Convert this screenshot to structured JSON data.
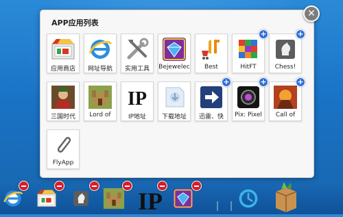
{
  "panel": {
    "title": "APP应用列表",
    "close_glyph": "✕"
  },
  "apps": [
    {
      "label": "应用商店",
      "icon": "app-store-icon",
      "add": false
    },
    {
      "label": "网址导航",
      "icon": "ie-browser-icon",
      "add": false
    },
    {
      "label": "实用工具",
      "icon": "tools-icon",
      "add": false
    },
    {
      "label": "Bejewelec",
      "icon": "bejeweled-gem-icon",
      "add": false
    },
    {
      "label": "Best",
      "icon": "best-cart-icon",
      "add": false
    },
    {
      "label": "HitFT",
      "icon": "hitft-blocks-icon",
      "add": true
    },
    {
      "label": "Chess!",
      "icon": "chess-knight-icon",
      "add": true
    },
    {
      "label": "三国时代",
      "icon": "three-kingdoms-warrior-icon",
      "add": false
    },
    {
      "label": "Lord of",
      "icon": "lord-of-castle-icon",
      "add": false
    },
    {
      "label": "IP地址",
      "icon": "ip-text-icon",
      "add": false
    },
    {
      "label": "下载地址",
      "icon": "download-address-icon",
      "add": false
    },
    {
      "label": "迅雷、快",
      "icon": "arrow-right-icon",
      "add": true
    },
    {
      "label": "Pix: Pixel",
      "icon": "camera-lens-icon",
      "add": true
    },
    {
      "label": "Call of",
      "icon": "call-of-game-icon",
      "add": true
    },
    {
      "label": "FlyApp",
      "icon": "paperclip-icon",
      "add": false
    }
  ],
  "dock": [
    {
      "icon": "ie-browser-icon",
      "removable": true
    },
    {
      "icon": "app-store-icon",
      "removable": true
    },
    {
      "icon": "chess-knight-icon",
      "removable": true
    },
    {
      "icon": "lord-of-castle-icon",
      "removable": true
    },
    {
      "icon": "ip-text-icon",
      "removable": true
    },
    {
      "icon": "bejeweled-gem-icon",
      "removable": true
    },
    {
      "icon": "clock-refresh-icon",
      "removable": false
    },
    {
      "icon": "box-package-icon",
      "removable": false
    }
  ],
  "colors": {
    "add_badge": "#2f6fd8",
    "remove_badge": "#d51f2a"
  }
}
